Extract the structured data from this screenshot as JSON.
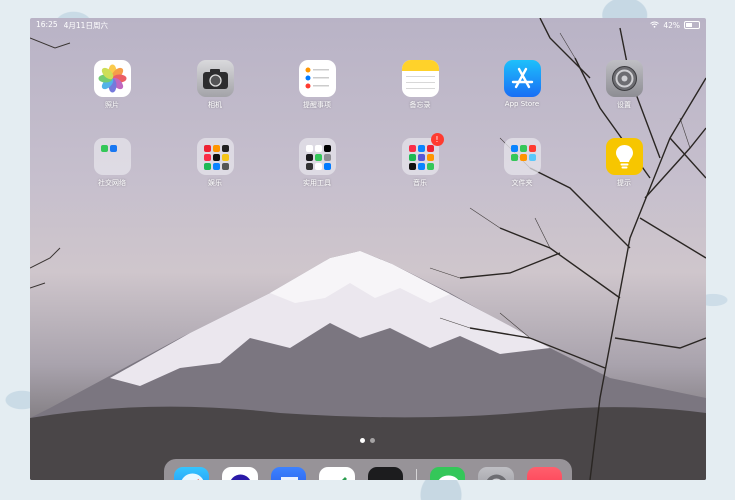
{
  "status_bar": {
    "time": "16:25",
    "date": "4月11日周六",
    "battery": "42%"
  },
  "apps": [
    {
      "label": "照片",
      "icon": "photos-icon"
    },
    {
      "label": "相机",
      "icon": "camera-icon"
    },
    {
      "label": "提醒事项",
      "icon": "reminders-icon"
    },
    {
      "label": "备忘录",
      "icon": "notes-icon"
    },
    {
      "label": "App Store",
      "icon": "app-store-icon"
    },
    {
      "label": "设置",
      "icon": "settings-icon"
    },
    {
      "label": "社交网络",
      "icon": "folder-icon"
    },
    {
      "label": "娱乐",
      "icon": "folder-icon"
    },
    {
      "label": "实用工具",
      "icon": "folder-icon"
    },
    {
      "label": "音乐",
      "icon": "folder-icon",
      "badge": "!"
    },
    {
      "label": "文件夹",
      "icon": "folder-icon"
    },
    {
      "label": "提示",
      "icon": "tips-icon"
    }
  ],
  "page_indicator": {
    "pages": 2,
    "current": 1
  },
  "dock": [
    "safari-icon",
    "blue-app-icon",
    "keynote-icon",
    "pages-icon",
    "dark-app-icon",
    "messages-icon",
    "settings-icon",
    "music-icon"
  ],
  "colors": {
    "badge": "#ff3b30",
    "app_store": "#1a8cff",
    "tips": "#f7c600",
    "notes": "#ffd22a"
  }
}
